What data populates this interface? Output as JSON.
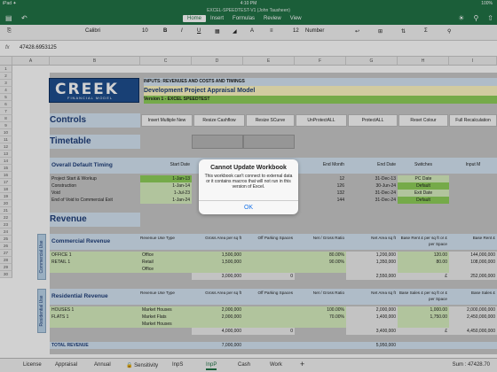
{
  "status": {
    "left": "iPad ✦",
    "time": "4:10 PM",
    "right": "100%"
  },
  "title": {
    "document": "EXCEL-SPEEDTEST-V1 (John Tausheen)"
  },
  "tabs": [
    "Home",
    "Insert",
    "Formulas",
    "Review",
    "View"
  ],
  "ribbon": {
    "font": "Calibri",
    "size": "10",
    "bold": "B",
    "italic": "I",
    "underline": "U",
    "number_size": "12",
    "number_format": "Number"
  },
  "formula_bar": {
    "fx": "fx",
    "value": "47428.6953125"
  },
  "columns": [
    "A",
    "B",
    "C",
    "D",
    "E",
    "F",
    "G",
    "H",
    "I"
  ],
  "rows": [
    "1",
    "2",
    "3",
    "4",
    "5",
    "6",
    "7",
    "8",
    "9",
    "10",
    "11",
    "12",
    "13",
    "14",
    "15",
    "16",
    "17",
    "18",
    "19",
    "20",
    "21",
    "22",
    "23",
    "24",
    "25",
    "26",
    "27",
    "28",
    "29",
    "30"
  ],
  "logo": {
    "main": "CREEK",
    "sub": "FINANCIAL MODEL"
  },
  "header": {
    "inputs": "INPUTS: REVENUES AND COSTS AND TIMINGS",
    "model": "Development Project Appraisal Model",
    "version": "Version 1 - EXCEL SPEEDTEST"
  },
  "controls": {
    "title": "Controls",
    "buttons": [
      "Insert Multiple New",
      "Resize Cashflow",
      "Resize SCurve",
      "UnProtectALL",
      "ProtectALL",
      "Reset Colour",
      "Full Recalculation"
    ]
  },
  "timetable": {
    "title": "Timetable",
    "heading": "Overall Default Timing",
    "cols": [
      "Start Date",
      "End Month",
      "End Date",
      "Switches",
      "Input M"
    ],
    "rows": [
      {
        "label": "Project Start & Workup",
        "start": "1-Jan-13",
        "end_month": "12",
        "end_date": "31-Dec-13",
        "switch": "PC Date"
      },
      {
        "label": "Construction",
        "start": "1-Jan-14",
        "end_month": "126",
        "end_date": "30-Jun-24",
        "switch": "Default"
      },
      {
        "label": "Void",
        "start": "1-Jul-23",
        "end_month": "132",
        "end_date": "31-Dec-24",
        "switch": "Exit Date"
      },
      {
        "label": "End of Void to Commercial Exit",
        "start": "1-Jan-24",
        "end_month": "144",
        "end_date": "31-Dec-24",
        "switch": "Default"
      }
    ]
  },
  "revenue": {
    "title": "Revenue"
  },
  "commercial": {
    "tab": "Commercial Use",
    "title": "Commercial Revenue",
    "cols": [
      "Revenue Use Type",
      "Gross Area per sq ft",
      "Off Parking Spaces",
      "Net / Gross Ratio",
      "Net Area sq ft",
      "Base Rent £ per sq ft or £ per Space",
      "Base Rent £"
    ],
    "rows": [
      {
        "label": "OFFICE 1",
        "type": "Office",
        "gross": "1,500,000",
        "ratio": "80.00%",
        "net": "1,200,000",
        "rent": "120.00",
        "base": "144,000,000"
      },
      {
        "label": "RETAIL 1",
        "type": "Retail",
        "gross": "1,500,000",
        "ratio": "90.00%",
        "net": "1,350,000",
        "rent": "80.00",
        "base": "108,000,000"
      },
      {
        "label": "",
        "type": "Office",
        "gross": "",
        "ratio": "",
        "net": "",
        "rent": "",
        "base": ""
      }
    ],
    "total": {
      "gross": "3,000,000",
      "parking": "0",
      "net": "2,550,000",
      "rent": "£",
      "base": "252,000,000"
    }
  },
  "residential": {
    "tab": "Residential Use",
    "title": "Residential Revenue",
    "cols": [
      "Revenue Use Type",
      "Gross Area per sq ft",
      "Off Parking Spaces",
      "Net / Gross Ratio",
      "Net Area sq ft",
      "Base Sales £ per sq ft or £ per Space",
      "Base Sales £"
    ],
    "rows": [
      {
        "label": "HOUSES 1",
        "type": "Market Houses",
        "gross": "2,000,000",
        "ratio": "100.00%",
        "net": "2,000,000",
        "rent": "1,000.00",
        "base": "2,000,000,000"
      },
      {
        "label": "FLATS 1",
        "type": "Market Flats",
        "gross": "2,000,000",
        "ratio": "70.00%",
        "net": "1,400,000",
        "rent": "1,750.00",
        "base": "2,450,000,000"
      },
      {
        "label": "",
        "type": "Market Houses",
        "gross": "",
        "ratio": "",
        "net": "",
        "rent": "",
        "base": ""
      }
    ],
    "total": {
      "gross": "4,000,000",
      "parking": "0",
      "net": "3,400,000",
      "rent": "£",
      "base": "4,450,000,000"
    }
  },
  "total_revenue": {
    "label": "TOTAL REVENUE",
    "gross": "7,000,000",
    "net": "5,950,000"
  },
  "sheets": [
    "License",
    "Appraisal",
    "Annual",
    "🔒 Sensitivity",
    "InpS",
    "InpP",
    "Cash",
    "Work",
    "+"
  ],
  "sum": "Sum : 47428.70",
  "dialog": {
    "title": "Cannot Update Workbook",
    "message": "This workbook can't connect to external data or it contains macros that will not run in this version of Excel.",
    "ok": "OK"
  }
}
